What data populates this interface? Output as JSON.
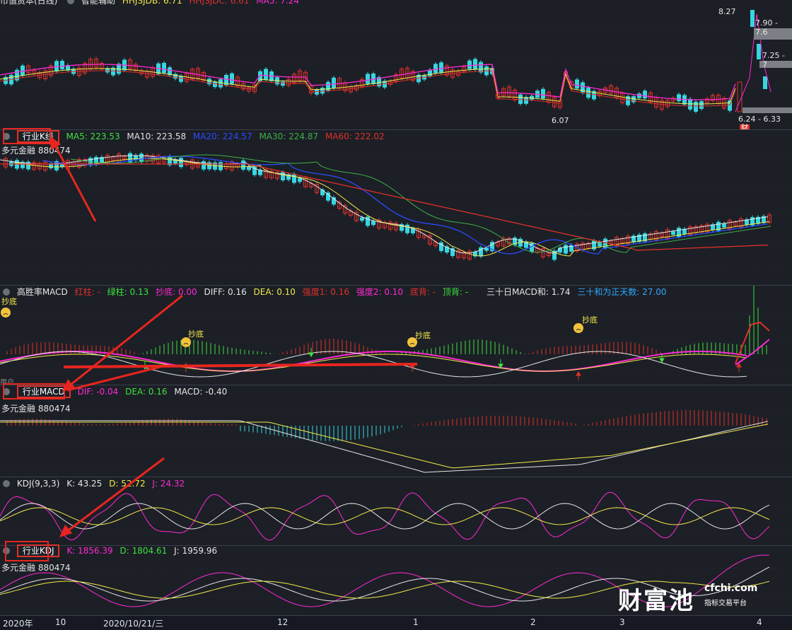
{
  "top_panel": {
    "title_partial": "市值资本(日线)",
    "indicator": "智能辅助",
    "vals": [
      "HHJSJDB: 6.71",
      "HHJSJDC: 6.61",
      "MA5: 7.24"
    ],
    "price_labels": [
      "8.27",
      "7.90 - 7.6",
      "7.25 - 7",
      "6.24 - 6.33",
      "6.07"
    ],
    "badge": "财"
  },
  "kline": {
    "label": "行业K线",
    "code": "多元金融  880474",
    "ma": [
      {
        "text": "MA5: 223.53",
        "color": "#3ee23e"
      },
      {
        "text": "MA10: 223.58",
        "color": "#e0e0e0"
      },
      {
        "text": "MA20: 224.57",
        "color": "#2a4cff"
      },
      {
        "text": "MA30: 224.87",
        "color": "#3fb04a"
      },
      {
        "text": "MA60: 222.02",
        "color": "#e0302b"
      }
    ]
  },
  "macd_hi": {
    "title": "高胜率MACD",
    "items": [
      {
        "text": "红柱: -",
        "color": "#e0302b"
      },
      {
        "text": "绿柱: 0.13",
        "color": "#3ee23e"
      },
      {
        "text": "抄底: 0.00",
        "color": "#ff2ad4"
      },
      {
        "text": "DIFF: 0.16",
        "color": "#e6e6e6"
      },
      {
        "text": "DEA: 0.10",
        "color": "#f2e94a"
      },
      {
        "text": "强度1: 0.16",
        "color": "#e0302b"
      },
      {
        "text": "强度2: 0.10",
        "color": "#ff2ad4"
      },
      {
        "text": "底背: -",
        "color": "#e0302b"
      },
      {
        "text": "顶背: -",
        "color": "#3ee23e"
      },
      {
        "text": "三十日MACD和: 1.74",
        "color": "#e6e6e6"
      },
      {
        "text": "三十和为正天数: 27.00",
        "color": "#2fa8ff"
      }
    ],
    "bottom_signal": "抄底",
    "tag": "用户"
  },
  "industry_macd": {
    "label": "行业MACD",
    "code": "多元金融  880474",
    "items": [
      {
        "text": "DIF: -0.04",
        "color": "#ff2ad4"
      },
      {
        "text": "DEA: 0.16",
        "color": "#3ee23e"
      },
      {
        "text": "MACD: -0.40",
        "color": "#e6e6e6"
      }
    ]
  },
  "kdj": {
    "title": "KDJ(9,3,3)",
    "items": [
      {
        "text": "K: 43.25",
        "color": "#e6e6e6"
      },
      {
        "text": "D: 52.72",
        "color": "#f2e94a"
      },
      {
        "text": "J: 24.32",
        "color": "#ff2ad4"
      }
    ]
  },
  "industry_kdj": {
    "label": "行业KDJ",
    "code": "多元金融  880474",
    "items": [
      {
        "text": "K: 1856.39",
        "color": "#ff2ad4"
      },
      {
        "text": "D: 1804.61",
        "color": "#3ee23e"
      },
      {
        "text": "J: 1959.96",
        "color": "#e6e6e6"
      }
    ]
  },
  "axis": {
    "labels": [
      "2020年",
      "10",
      "2020/10/21/三",
      "12",
      "1",
      "2",
      "3",
      "4"
    ]
  },
  "logo": {
    "cn": "财富池",
    "site": "cfchi.com",
    "tag": "指标交易平台"
  },
  "colors": {
    "bg": "#1c1f26",
    "red": "#e0302b",
    "cyan": "#36d6e0",
    "arrow": "#e8261f"
  }
}
